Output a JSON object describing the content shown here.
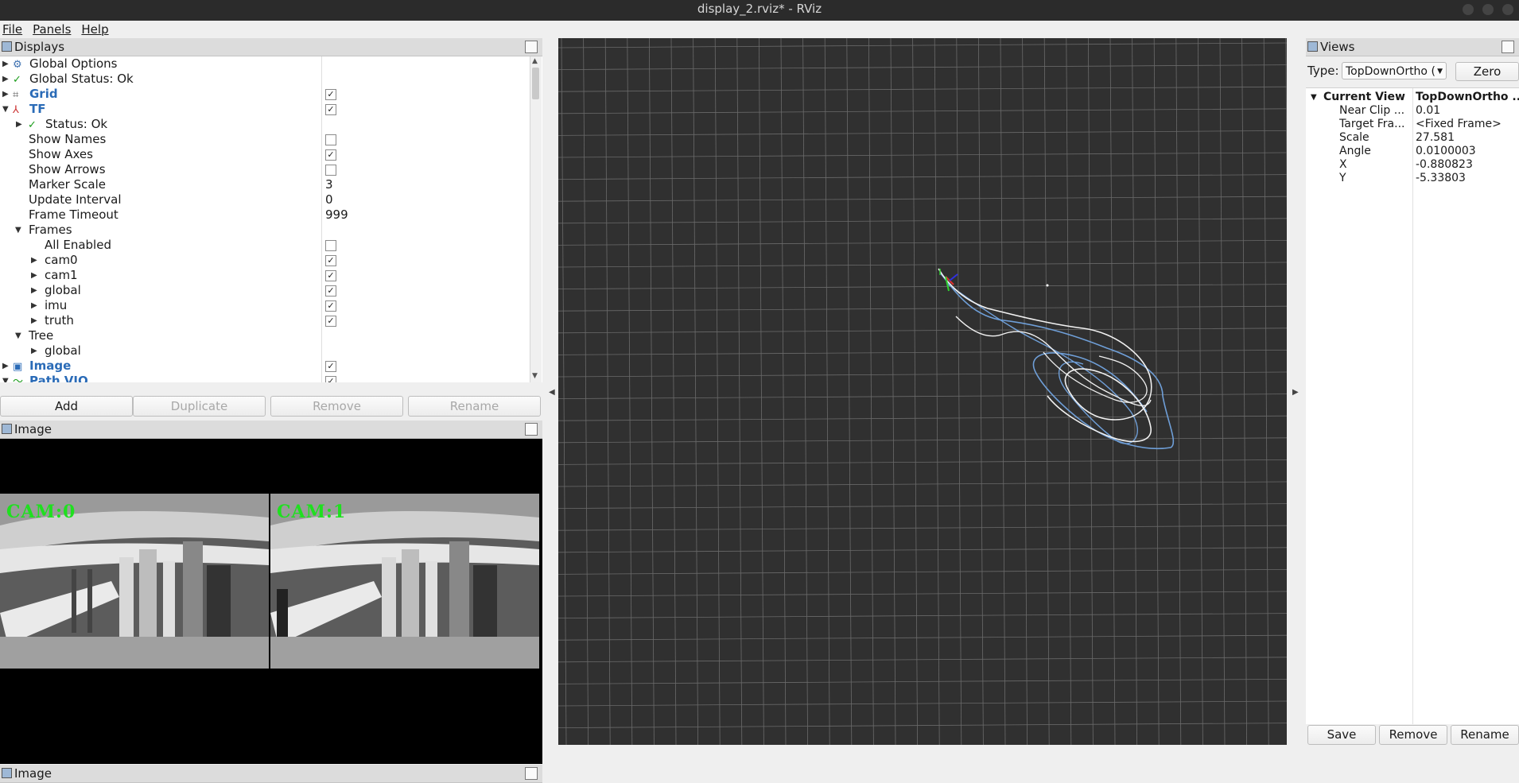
{
  "window": {
    "title": "display_2.rviz* - RViz"
  },
  "menu": {
    "file": "File",
    "panels": "Panels",
    "help": "Help"
  },
  "displays": {
    "title": "Displays",
    "rows": {
      "global_options": "Global Options",
      "global_status": "Global Status: Ok",
      "grid": "Grid",
      "tf": "TF",
      "tf_status": "Status: Ok",
      "show_names": "Show Names",
      "show_axes": "Show Axes",
      "show_arrows": "Show Arrows",
      "marker_scale": "Marker Scale",
      "marker_scale_value": "3",
      "update_interval": "Update Interval",
      "update_interval_value": "0",
      "frame_timeout": "Frame Timeout",
      "frame_timeout_value": "999",
      "frames": "Frames",
      "all_enabled": "All Enabled",
      "cam0": "cam0",
      "cam1": "cam1",
      "global": "global",
      "imu": "imu",
      "truth": "truth",
      "tree": "Tree",
      "tree_global": "global",
      "image": "Image",
      "path_vio": "Path VIO"
    },
    "buttons": {
      "add": "Add",
      "duplicate": "Duplicate",
      "remove": "Remove",
      "rename": "Rename"
    }
  },
  "image_panel": {
    "title": "Image",
    "cam0_label": "CAM:0",
    "cam1_label": "CAM:1"
  },
  "image_panel_2": {
    "title": "Image"
  },
  "views": {
    "title": "Views",
    "type_label": "Type:",
    "type_value": "TopDownOrtho (",
    "zero": "Zero",
    "current_view": "Current View",
    "current_view_value": "TopDownOrtho ...",
    "props": [
      {
        "k": "Near Clip ...",
        "v": "0.01"
      },
      {
        "k": "Target Fra...",
        "v": "<Fixed Frame>"
      },
      {
        "k": "Scale",
        "v": "27.581"
      },
      {
        "k": "Angle",
        "v": "0.0100003"
      },
      {
        "k": "X",
        "v": "-0.880823"
      },
      {
        "k": "Y",
        "v": "-5.33803"
      }
    ],
    "save": "Save",
    "remove": "Remove",
    "rename": "Rename"
  },
  "colors": {
    "viewport_bg": "#303030",
    "grid_line": "#6a6a6a",
    "path_white": "#f2f2f2",
    "path_blue": "#6f9fd8",
    "check_green": "#1a9c1a",
    "cam_label": "#1fe01f"
  }
}
